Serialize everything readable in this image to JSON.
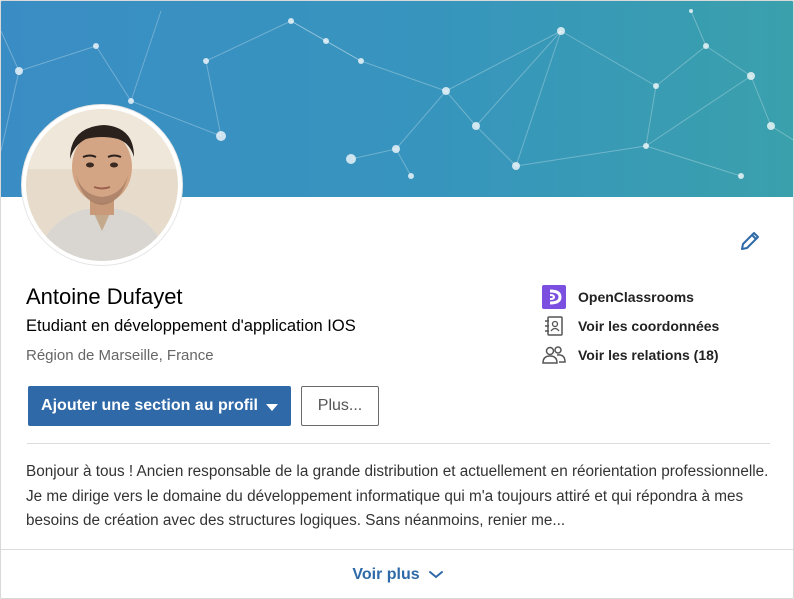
{
  "profile": {
    "name": "Antoine Dufayet",
    "headline": "Etudiant en développement d'application IOS",
    "location": "Région de Marseille, France"
  },
  "actions": {
    "add_section_label": "Ajouter une section au profil",
    "more_label": "Plus..."
  },
  "side": {
    "company": "OpenClassrooms",
    "contact": "Voir les coordonnées",
    "connections": "Voir les relations (18)"
  },
  "summary": {
    "text": "Bonjour à tous ! Ancien responsable de la grande distribution et actuellement en réorientation professionnelle. Je me dirige vers le domaine du développement informatique qui m'a toujours attiré et qui répondra à mes besoins de création avec des structures logiques. Sans néanmoins, renier me..."
  },
  "footer": {
    "see_more_label": "Voir plus"
  },
  "icons": {
    "edit": "pencil-icon",
    "company": "openclassrooms-logo-icon",
    "contact": "address-book-icon",
    "connections": "people-icon",
    "see_more": "chevron-down-icon"
  },
  "colors": {
    "primary": "#2f69a8",
    "link": "#2f6aa8",
    "company_logo": "#7b4fe0",
    "banner_start": "#3a8dc4",
    "banner_end": "#3aa0ac"
  }
}
